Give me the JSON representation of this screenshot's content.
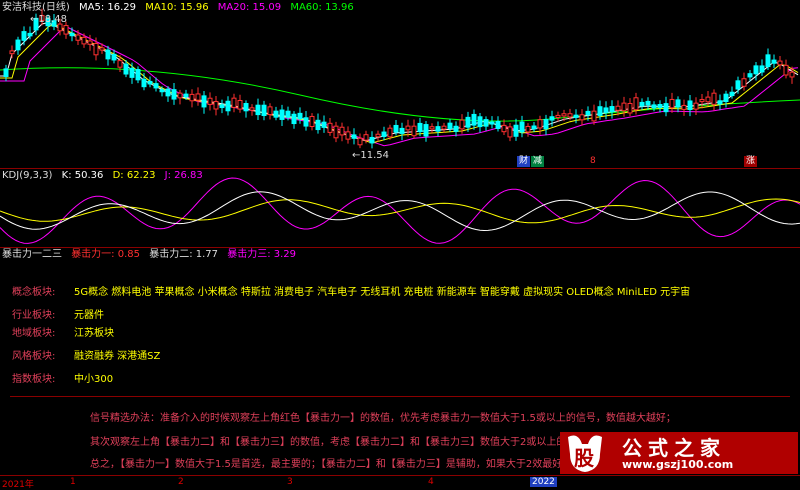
{
  "main_panel": {
    "title": "安洁科技(日线)",
    "ma5": "MA5: 16.29",
    "ma10": "MA10: 15.96",
    "ma20": "MA20: 15.09",
    "ma60": "MA60: 13.96",
    "high_label": "←18.48",
    "low_label": "←11.54",
    "badges": [
      "财",
      "减",
      "8",
      "涨"
    ],
    "colors": {
      "ma5": "#ffffff",
      "ma10": "#ffff00",
      "ma20": "#ff00ff",
      "ma60": "#00ff00",
      "up": "#ff3030",
      "down": "#00ffff"
    }
  },
  "kdj_panel": {
    "title": "KDJ(9,3,3)",
    "k": "K: 50.36",
    "d": "D: 62.23",
    "j": "J: 26.83"
  },
  "info_panel": {
    "title": "暴击力一二三",
    "p1": "暴击力一: 0.85",
    "p2": "暴击力二: 1.77",
    "p3": "暴击力三: 3.29",
    "rows": [
      {
        "key": "概念板块:",
        "value": "5G概念 燃料电池 苹果概念 小米概念 特斯拉 消费电子 汽车电子 无线耳机 充电桩 新能源车 智能穿戴 虚拟现实 OLED概念 MiniLED 元宇宙"
      },
      {
        "key": "行业板块:",
        "value": "元器件"
      },
      {
        "key": "地域板块:",
        "value": "江苏板块"
      },
      {
        "key": "风格板块:",
        "value": "融资融券 深港通SZ"
      },
      {
        "key": "指数板块:",
        "value": "中小300"
      }
    ],
    "notes": [
      "信号精选办法：准备介入的时候观察左上角红色【暴击力一】的数值，优先考虑暴击力一数值大于1.5或以上的信号，数值越大越好；",
      "其次观察左上角【暴击力二】和【暴击力三】的数值，考虑【暴击力二】和【暴击力三】数值大于2或以上的信号，数",
      "总之，【暴击力一】数值大于1.5是首选，最主要的；【暴击力二】和【暴击力三】是辅助，如果大于2效最好，没有"
    ]
  },
  "axis": {
    "labels": [
      "2021年",
      "1",
      "2",
      "3",
      "4",
      "2022"
    ]
  },
  "logo": {
    "icon_text": "股",
    "name": "公式之家",
    "url": "www.gszj100.com"
  }
}
